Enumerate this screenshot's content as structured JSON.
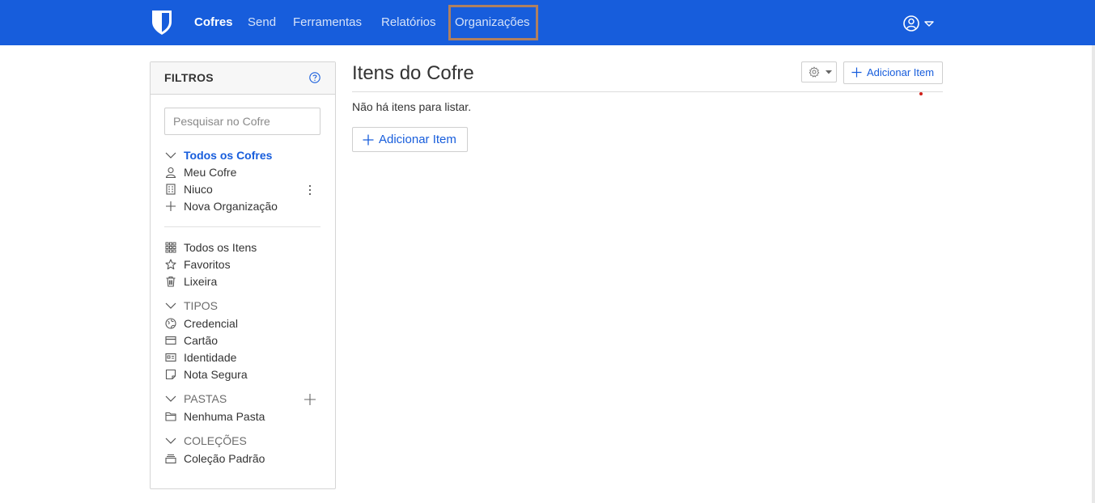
{
  "nav": {
    "items": [
      {
        "label": "Cofres",
        "active": true
      },
      {
        "label": "Send",
        "active": false
      },
      {
        "label": "Ferramentas",
        "active": false
      },
      {
        "label": "Relatórios",
        "active": false
      },
      {
        "label": "Organizações",
        "active": false,
        "highlighted": true
      }
    ],
    "brand_color": "#175ddc",
    "highlight_color": "#b08060"
  },
  "filters": {
    "title": "FILTROS",
    "search_placeholder": "Pesquisar no Cofre",
    "vaults": {
      "all_label": "Todos os Cofres",
      "items": [
        {
          "icon": "user-icon",
          "label": "Meu Cofre"
        },
        {
          "icon": "building-icon",
          "label": "Niuco"
        },
        {
          "icon": "plus-icon",
          "label": "Nova Organização"
        }
      ]
    },
    "general": [
      {
        "icon": "grid-icon",
        "label": "Todos os Itens"
      },
      {
        "icon": "star-icon",
        "label": "Favoritos"
      },
      {
        "icon": "trash-icon",
        "label": "Lixeira"
      }
    ],
    "types": {
      "header": "TIPOS",
      "items": [
        {
          "icon": "globe-icon",
          "label": "Credencial"
        },
        {
          "icon": "credit-card-icon",
          "label": "Cartão"
        },
        {
          "icon": "id-card-icon",
          "label": "Identidade"
        },
        {
          "icon": "sticky-note-icon",
          "label": "Nota Segura"
        }
      ]
    },
    "folders": {
      "header": "PASTAS",
      "items": [
        {
          "icon": "folder-icon",
          "label": "Nenhuma Pasta"
        }
      ]
    },
    "collections": {
      "header": "COLEÇÕES",
      "items": [
        {
          "icon": "collection-icon",
          "label": "Coleção Padrão"
        }
      ]
    }
  },
  "main": {
    "title": "Itens do Cofre",
    "add_item_label": "Adicionar Item",
    "empty_message": "Não há itens para listar.",
    "add_item_main_label": "Adicionar Item"
  }
}
